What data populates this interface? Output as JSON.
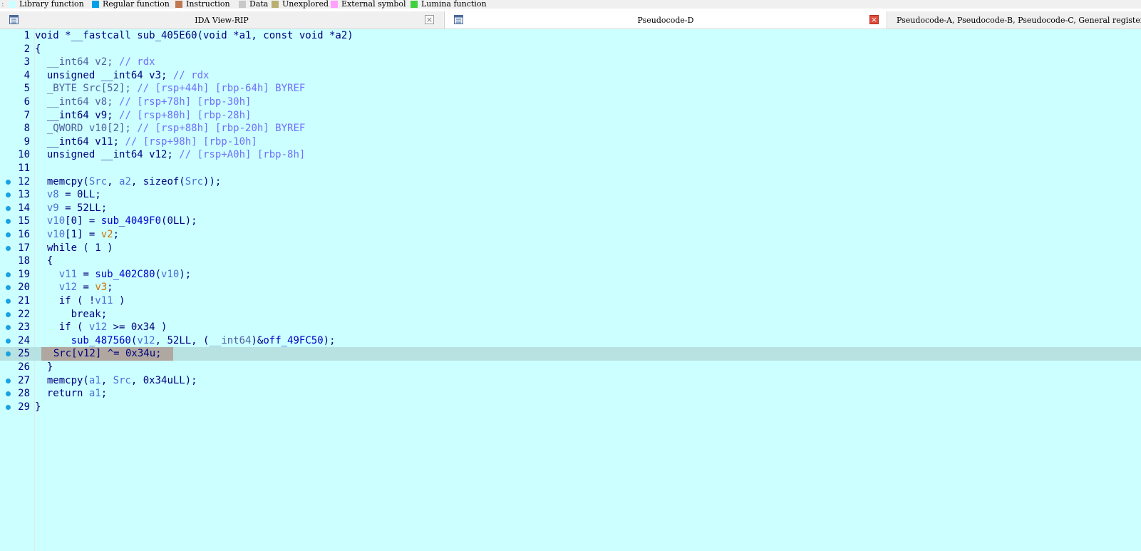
{
  "legend": {
    "items": [
      {
        "label": "Library function",
        "color": "#ccffff"
      },
      {
        "label": "Regular function",
        "color": "#00a0e8"
      },
      {
        "label": "Instruction",
        "color": "#c07850"
      },
      {
        "label": "Data",
        "color": "#c8c8c8"
      },
      {
        "label": "Unexplored",
        "color": "#b8b070"
      },
      {
        "label": "External symbol",
        "color": "#ffa0ff"
      },
      {
        "label": "Lumina function",
        "color": "#40d040"
      }
    ]
  },
  "tabs": {
    "ida_view": {
      "label": "IDA View-RIP",
      "close": "×"
    },
    "pseudocode_d": {
      "label": "Pseudocode-D",
      "close": "×"
    },
    "others": {
      "label": "Pseudocode-A, Pseudocode-B, Pseudocode-C, General registers, ..."
    }
  },
  "colors": {
    "editor_bg": "#ccffff",
    "current_line": "#b8e2e2",
    "breakpoint_dot": "#1ba1e2"
  },
  "code": {
    "current_line": 25,
    "lines": [
      {
        "n": "1",
        "dot": false,
        "tokens": [
          [
            "void *__fastcall sub_405E60(void *a1, const void *a2)",
            "p"
          ]
        ]
      },
      {
        "n": "2",
        "dot": false,
        "tokens": [
          [
            "{",
            "p"
          ]
        ]
      },
      {
        "n": "3",
        "dot": false,
        "tokens": [
          [
            "  __int64 v2; ",
            "ty"
          ],
          [
            "// rdx",
            "cm"
          ]
        ]
      },
      {
        "n": "4",
        "dot": false,
        "tokens": [
          [
            "  unsigned __int64 v3; ",
            "p"
          ],
          [
            "// rdx",
            "cm"
          ]
        ]
      },
      {
        "n": "5",
        "dot": false,
        "tokens": [
          [
            "  _BYTE Src[52]; ",
            "ty"
          ],
          [
            "// [rsp+44h] [rbp-64h] BYREF",
            "cm"
          ]
        ]
      },
      {
        "n": "6",
        "dot": false,
        "tokens": [
          [
            "  __int64 v8; ",
            "ty"
          ],
          [
            "// [rsp+78h] [rbp-30h]",
            "cm"
          ]
        ]
      },
      {
        "n": "7",
        "dot": false,
        "tokens": [
          [
            "  __int64 v9; ",
            "p"
          ],
          [
            "// [rsp+80h] [rbp-28h]",
            "cm"
          ]
        ]
      },
      {
        "n": "8",
        "dot": false,
        "tokens": [
          [
            "  _QWORD v10[2]; ",
            "ty"
          ],
          [
            "// [rsp+88h] [rbp-20h] BYREF",
            "cm"
          ]
        ]
      },
      {
        "n": "9",
        "dot": false,
        "tokens": [
          [
            "  __int64 v11; ",
            "p"
          ],
          [
            "// [rsp+98h] [rbp-10h]",
            "cm"
          ]
        ]
      },
      {
        "n": "10",
        "dot": false,
        "tokens": [
          [
            "  unsigned __int64 v12; ",
            "p"
          ],
          [
            "// [rsp+A0h] [rbp-8h]",
            "cm"
          ]
        ]
      },
      {
        "n": "11",
        "dot": false,
        "tokens": [
          [
            "",
            "p"
          ]
        ]
      },
      {
        "n": "12",
        "dot": true,
        "tokens": [
          [
            "  memcpy(",
            "p"
          ],
          [
            "Src",
            "v"
          ],
          [
            ", ",
            "p"
          ],
          [
            "a2",
            "v"
          ],
          [
            ", sizeof(",
            "p"
          ],
          [
            "Src",
            "v"
          ],
          [
            "));",
            "p"
          ]
        ]
      },
      {
        "n": "13",
        "dot": true,
        "tokens": [
          [
            "  ",
            "p"
          ],
          [
            "v8",
            "v"
          ],
          [
            " = 0LL;",
            "p"
          ]
        ]
      },
      {
        "n": "14",
        "dot": true,
        "tokens": [
          [
            "  ",
            "p"
          ],
          [
            "v9",
            "v"
          ],
          [
            " = 52LL;",
            "p"
          ]
        ]
      },
      {
        "n": "15",
        "dot": true,
        "tokens": [
          [
            "  ",
            "p"
          ],
          [
            "v10",
            "v"
          ],
          [
            "[0] = ",
            "p"
          ],
          [
            "sub_4049F0",
            "fn"
          ],
          [
            "(0LL);",
            "p"
          ]
        ]
      },
      {
        "n": "16",
        "dot": true,
        "tokens": [
          [
            "  ",
            "p"
          ],
          [
            "v10",
            "v"
          ],
          [
            "[1] = ",
            "p"
          ],
          [
            "v2",
            "o"
          ],
          [
            ";",
            "p"
          ]
        ]
      },
      {
        "n": "17",
        "dot": true,
        "tokens": [
          [
            "  while ( 1 )",
            "p"
          ]
        ]
      },
      {
        "n": "18",
        "dot": false,
        "tokens": [
          [
            "  {",
            "p"
          ]
        ]
      },
      {
        "n": "19",
        "dot": true,
        "tokens": [
          [
            "    ",
            "p"
          ],
          [
            "v11",
            "v"
          ],
          [
            " = ",
            "p"
          ],
          [
            "sub_402C80",
            "fn"
          ],
          [
            "(",
            "p"
          ],
          [
            "v10",
            "v"
          ],
          [
            ");",
            "p"
          ]
        ]
      },
      {
        "n": "20",
        "dot": true,
        "tokens": [
          [
            "    ",
            "p"
          ],
          [
            "v12",
            "v"
          ],
          [
            " = ",
            "p"
          ],
          [
            "v3",
            "o"
          ],
          [
            ";",
            "p"
          ]
        ]
      },
      {
        "n": "21",
        "dot": true,
        "tokens": [
          [
            "    if ( !",
            "p"
          ],
          [
            "v11",
            "v"
          ],
          [
            " )",
            "p"
          ]
        ]
      },
      {
        "n": "22",
        "dot": true,
        "tokens": [
          [
            "      break;",
            "p"
          ]
        ]
      },
      {
        "n": "23",
        "dot": true,
        "tokens": [
          [
            "    if ( ",
            "p"
          ],
          [
            "v12",
            "v"
          ],
          [
            " >= 0x34 )",
            "p"
          ]
        ]
      },
      {
        "n": "24",
        "dot": true,
        "tokens": [
          [
            "      ",
            "p"
          ],
          [
            "sub_487560",
            "fn"
          ],
          [
            "(",
            "p"
          ],
          [
            "v12",
            "v"
          ],
          [
            ", 52LL, (",
            "p"
          ],
          [
            "__int64",
            "ty"
          ],
          [
            ")&",
            "p"
          ],
          [
            "off_49FC50",
            "fn"
          ],
          [
            ");",
            "p"
          ]
        ]
      },
      {
        "n": "25",
        "dot": true,
        "tokens": [
          [
            "  Src[v12] ^= 0x34u; ",
            "p"
          ]
        ]
      },
      {
        "n": "26",
        "dot": false,
        "tokens": [
          [
            "  }",
            "p"
          ]
        ]
      },
      {
        "n": "27",
        "dot": true,
        "tokens": [
          [
            "  memcpy(",
            "p"
          ],
          [
            "a1",
            "v"
          ],
          [
            ", ",
            "p"
          ],
          [
            "Src",
            "v"
          ],
          [
            ", 0x34uLL);",
            "p"
          ]
        ]
      },
      {
        "n": "28",
        "dot": true,
        "tokens": [
          [
            "  return ",
            "p"
          ],
          [
            "a1",
            "v"
          ],
          [
            ";",
            "p"
          ]
        ]
      },
      {
        "n": "29",
        "dot": true,
        "tokens": [
          [
            "}",
            "p"
          ]
        ]
      }
    ]
  }
}
